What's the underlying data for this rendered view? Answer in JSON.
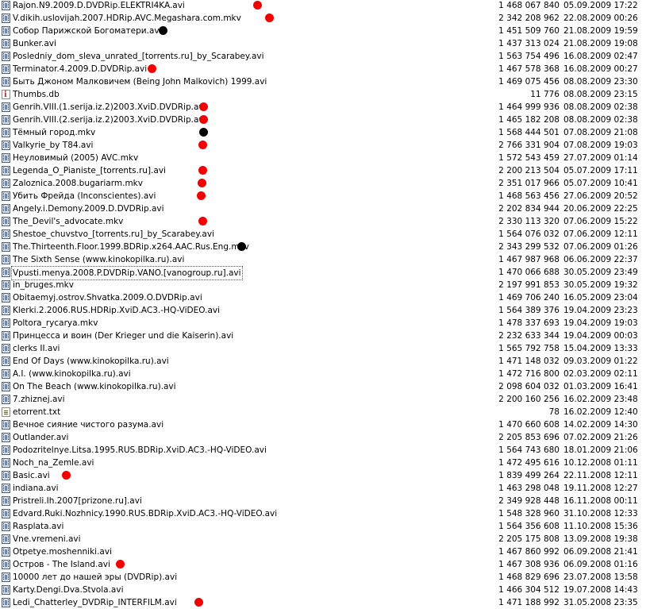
{
  "colors": {
    "marker_red": "#f20000",
    "marker_black": "#000000"
  },
  "files": [
    {
      "name": "Rajon.N9.2009.D.DVDRip.ELEKTRI4KA.avi",
      "size": "1 468 067 840",
      "date": "05.09.2009 17:22",
      "icon": "video-file-icon",
      "marker": "red"
    },
    {
      "name": "V.dikih.uslovijah.2007.HDRip.AVC.Megashara.com.mkv",
      "size": "2 342 208 962",
      "date": "22.08.2009 00:26",
      "icon": "video-file-icon",
      "marker": "red"
    },
    {
      "name": "Собор Парижской Богоматери.avi",
      "size": "1 451 509 760",
      "date": "21.08.2009 19:59",
      "icon": "video-file-icon",
      "marker": "black"
    },
    {
      "name": "Bunker.avi",
      "size": "1 437 313 024",
      "date": "21.08.2009 19:08",
      "icon": "video-file-icon",
      "marker": ""
    },
    {
      "name": "Posledniy_dom_sleva_unrated_[torrents.ru]_by_Scarabey.avi",
      "size": "1 563 754 496",
      "date": "16.08.2009 02:47",
      "icon": "video-file-icon",
      "marker": ""
    },
    {
      "name": "Terminator.4.2009.D.DVDRip.avi",
      "size": "1 467 578 368",
      "date": "16.08.2009 00:27",
      "icon": "video-file-icon",
      "marker": "red"
    },
    {
      "name": "Быть Джоном Малковичем (Being John Malkovich) 1999.avi",
      "size": "1 469 075 456",
      "date": "08.08.2009 23:30",
      "icon": "video-file-icon",
      "marker": ""
    },
    {
      "name": "Thumbs.db",
      "size": "11 776",
      "date": "08.08.2009 23:15",
      "icon": "db-file-icon",
      "marker": ""
    },
    {
      "name": "Genrih.VIII.(1.serija.iz.2)2003.XviD.DVDRip.avi",
      "size": "1 464 999 936",
      "date": "08.08.2009 02:38",
      "icon": "video-file-icon",
      "marker": "red"
    },
    {
      "name": "Genrih.VIII.(2.serija.iz.2)2003.XviD.DVDRip.avi",
      "size": "1 465 182 208",
      "date": "08.08.2009 02:38",
      "icon": "video-file-icon",
      "marker": "red"
    },
    {
      "name": "Тёмный город.mkv",
      "size": "1 568 444 501",
      "date": "07.08.2009 21:08",
      "icon": "video-file-icon",
      "marker": "black"
    },
    {
      "name": "Valkyrie_by T84.avi",
      "size": "2 766 331 904",
      "date": "07.08.2009 19:03",
      "icon": "video-file-icon",
      "marker": "red"
    },
    {
      "name": "Неуловимый (2005) AVC.mkv",
      "size": "1 572 543 459",
      "date": "27.07.2009 01:14",
      "icon": "video-file-icon",
      "marker": ""
    },
    {
      "name": "Legenda_O_Pianiste_[torrents.ru].avi",
      "size": "2 200 213 504",
      "date": "05.07.2009 17:11",
      "icon": "video-file-icon",
      "marker": "red"
    },
    {
      "name": "Zaloznica.2008.bugariarm.mkv",
      "size": "2 351 017 966",
      "date": "05.07.2009 10:41",
      "icon": "video-file-icon",
      "marker": "red"
    },
    {
      "name": "Убить Фрейда (Inconscientes).avi",
      "size": "1 468 563 456",
      "date": "27.06.2009 20:52",
      "icon": "video-file-icon",
      "marker": "red"
    },
    {
      "name": "Angely.i.Demony.2009.D.DVDRip.avi",
      "size": "2 202 834 944",
      "date": "20.06.2009 22:25",
      "icon": "video-file-icon",
      "marker": ""
    },
    {
      "name": "The_Devil's_advocate.mkv",
      "size": "2 330 113 320",
      "date": "07.06.2009 15:22",
      "icon": "video-file-icon",
      "marker": "red"
    },
    {
      "name": "Shestoe_chuvstvo_[torrents.ru]_by_Scarabey.avi",
      "size": "1 564 076 032",
      "date": "07.06.2009 12:11",
      "icon": "video-file-icon",
      "marker": ""
    },
    {
      "name": "The.Thirteenth.Floor.1999.BDRip.x264.AAC.Rus.Eng.mkv",
      "size": "2 343 299 532",
      "date": "07.06.2009 01:26",
      "icon": "video-file-icon",
      "marker": "black"
    },
    {
      "name": "The Sixth Sense (www.kinokopilka.ru).avi",
      "size": "1 467 987 968",
      "date": "06.06.2009 22:37",
      "icon": "video-file-icon",
      "marker": ""
    },
    {
      "name": "Vpusti.menya.2008.P.DVDRip.VANO.[vanogroup.ru].avi",
      "size": "1 470 066 688",
      "date": "30.05.2009 23:49",
      "icon": "video-file-icon",
      "marker": "",
      "selected": true
    },
    {
      "name": "in_bruges.mkv",
      "size": "2 197 991 853",
      "date": "30.05.2009 19:32",
      "icon": "video-file-icon",
      "marker": ""
    },
    {
      "name": "Obitaemyj.ostrov.Shvatka.2009.O.DVDRip.avi",
      "size": "1 469 706 240",
      "date": "16.05.2009 23:04",
      "icon": "video-file-icon",
      "marker": ""
    },
    {
      "name": "Klerki.2.2006.RUS.HDRip.XviD.AC3.-HQ-ViDEO.avi",
      "size": "1 564 389 376",
      "date": "19.04.2009 23:23",
      "icon": "video-file-icon",
      "marker": ""
    },
    {
      "name": "Poltora_rycarya.mkv",
      "size": "1 478 337 693",
      "date": "19.04.2009 19:03",
      "icon": "video-file-icon",
      "marker": ""
    },
    {
      "name": "Принцесса и воин (Der Krieger und die Kaiserin).avi",
      "size": "2 232 633 344",
      "date": "19.04.2009 00:03",
      "icon": "video-file-icon",
      "marker": ""
    },
    {
      "name": "clerks II.avi",
      "size": "1 565 792 758",
      "date": "15.04.2009 13:33",
      "icon": "video-file-icon",
      "marker": ""
    },
    {
      "name": "End Of Days (www.kinokopilka.ru).avi",
      "size": "1 471 148 032",
      "date": "09.03.2009 01:22",
      "icon": "video-file-icon",
      "marker": ""
    },
    {
      "name": "A.I. (www.kinokopilka.ru).avi",
      "size": "1 472 716 800",
      "date": "02.03.2009 02:11",
      "icon": "video-file-icon",
      "marker": ""
    },
    {
      "name": "On The Beach (www.kinokopilka.ru).avi",
      "size": "2 098 604 032",
      "date": "01.03.2009 16:41",
      "icon": "video-file-icon",
      "marker": ""
    },
    {
      "name": "7.zhiznej.avi",
      "size": "2 200 160 256",
      "date": "16.02.2009 23:48",
      "icon": "video-file-icon",
      "marker": ""
    },
    {
      "name": "etorrent.txt",
      "size": "78",
      "date": "16.02.2009 12:40",
      "icon": "text-file-icon",
      "marker": ""
    },
    {
      "name": "Вечное сияние чистого разума.avi",
      "size": "1 470 660 608",
      "date": "14.02.2009 14:30",
      "icon": "video-file-icon",
      "marker": ""
    },
    {
      "name": "Outlander.avi",
      "size": "2 205 853 696",
      "date": "07.02.2009 21:26",
      "icon": "video-file-icon",
      "marker": ""
    },
    {
      "name": "Podozritelnye.Litsa.1995.RUS.BDRip.XviD.AC3.-HQ-ViDEO.avi",
      "size": "1 564 743 680",
      "date": "18.01.2009 21:06",
      "icon": "video-file-icon",
      "marker": ""
    },
    {
      "name": "Noch_na_Zemle.avi",
      "size": "1 472 495 616",
      "date": "10.12.2008 01:11",
      "icon": "video-file-icon",
      "marker": ""
    },
    {
      "name": "Basic.avi",
      "size": "1 839 499 264",
      "date": "22.11.2008 12:11",
      "icon": "video-file-icon",
      "marker": "red"
    },
    {
      "name": "indiana.avi",
      "size": "1 463 298 048",
      "date": "19.11.2008 12:27",
      "icon": "video-file-icon",
      "marker": ""
    },
    {
      "name": "Pristreli.Ih.2007[prizone.ru].avi",
      "size": "2 349 928 448",
      "date": "16.11.2008 00:11",
      "icon": "video-file-icon",
      "marker": ""
    },
    {
      "name": "Edvard.Ruki.Nozhnicy.1990.RUS.BDRip.XviD.AC3.-HQ-ViDEO.avi",
      "size": "1 548 328 960",
      "date": "31.10.2008 12:33",
      "icon": "video-file-icon",
      "marker": ""
    },
    {
      "name": "Rasplata.avi",
      "size": "1 564 356 608",
      "date": "11.10.2008 15:36",
      "icon": "video-file-icon",
      "marker": ""
    },
    {
      "name": "Vne.vremeni.avi",
      "size": "2 205 175 808",
      "date": "13.09.2008 19:38",
      "icon": "video-file-icon",
      "marker": ""
    },
    {
      "name": "Otpetye.moshenniki.avi",
      "size": "1 467 860 992",
      "date": "06.09.2008 21:41",
      "icon": "video-file-icon",
      "marker": ""
    },
    {
      "name": "Остров - The Island.avi",
      "size": "1 467 308 936",
      "date": "06.09.2008 01:16",
      "icon": "video-file-icon",
      "marker": "red"
    },
    {
      "name": "10000 лет до нашей эры (DVDRip).avi",
      "size": "1 468 829 696",
      "date": "23.07.2008 13:58",
      "icon": "video-file-icon",
      "marker": ""
    },
    {
      "name": "Karty.Dengi.Dva.Stvola.avi",
      "size": "1 466 304 512",
      "date": "19.07.2008 14:43",
      "icon": "video-file-icon",
      "marker": ""
    },
    {
      "name": "Ledi_Chatterley_DVDRip_INTERFILM.avi",
      "size": "1 471 188 992",
      "date": "31.05.2008 23:35",
      "icon": "video-file-icon",
      "marker": "red"
    }
  ]
}
